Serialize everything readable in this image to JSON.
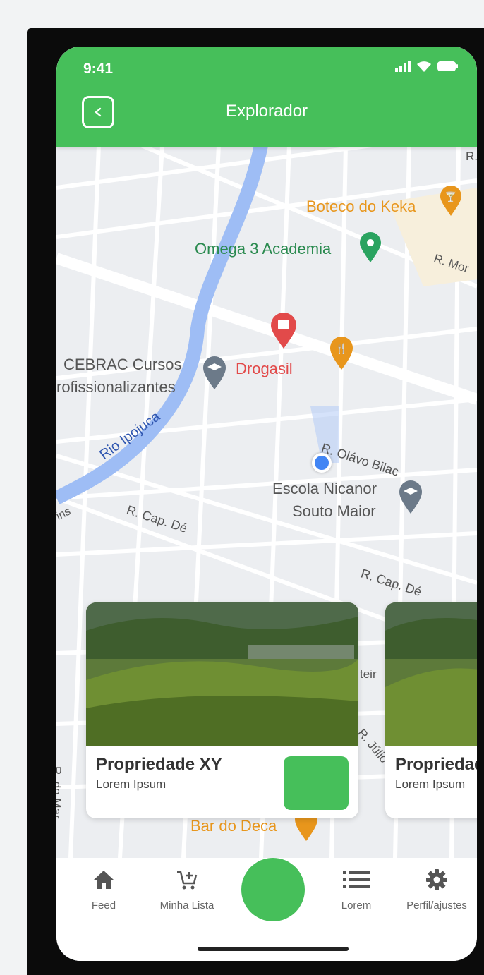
{
  "status": {
    "time": "9:41"
  },
  "header": {
    "title": "Explorador"
  },
  "map": {
    "labels": {
      "boteco": "Boteco do Keka",
      "omega": "Omega 3 Academia",
      "rmor": "R. Mor",
      "rtop": "R.",
      "cebrac1": "CEBRAC Cursos",
      "cebrac2": "rofissionalizantes",
      "drogasil": "Drogasil",
      "olavo": "R. Olávo Bilac",
      "escola1": "Escola Nicanor",
      "escola2": "Souto Maior",
      "rio": "Rio Ipojuca",
      "cap1": "R. Cap. Dé",
      "cap2": "R. Cap. Dé",
      "ins": "ins",
      "mar": "R. do Mar",
      "julio": "R. Júlio",
      "teir": "teir",
      "bar": "Bar do Deca"
    },
    "colors": {
      "restaurant": "#e8961c",
      "gym": "#2aa360",
      "pharmacy": "#e24a4a",
      "school": "#6c7a89",
      "water": "#9ebdf5",
      "location": "#4285f4"
    }
  },
  "cards": [
    {
      "title": "Propriedade XY",
      "subtitle": "Lorem Ipsum"
    },
    {
      "title": "Propriedade XY",
      "subtitle": "Lorem Ipsum"
    }
  ],
  "nav": {
    "feed": "Feed",
    "list": "Minha Lista",
    "lorem": "Lorem",
    "profile": "Perfil/ajustes"
  },
  "icons": [
    "signal-icon",
    "wifi-icon",
    "battery-icon",
    "back-icon",
    "home-icon",
    "cart-plus-icon",
    "list-icon",
    "gear-icon"
  ]
}
